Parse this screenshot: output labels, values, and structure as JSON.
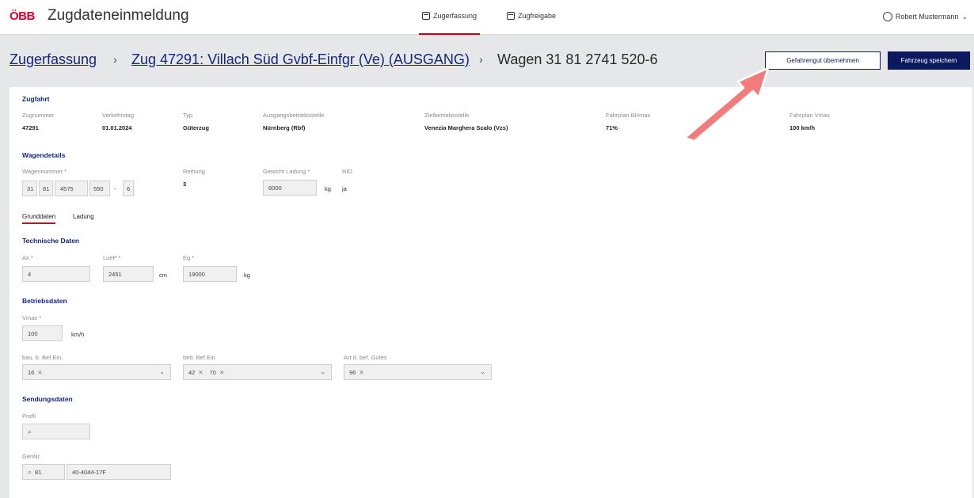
{
  "header": {
    "logo": "ÖBB",
    "title": "Zugdateneinmeldung",
    "nav": [
      {
        "label": "Zugerfassung",
        "active": true,
        "icon": "train-form-icon"
      },
      {
        "label": "Zugfreigabe",
        "active": false,
        "icon": "train-release-icon"
      }
    ],
    "user": "Robert Mustermann",
    "user_icon": "user-icon"
  },
  "breadcrumb": {
    "root": "Zugerfassung",
    "train": "Zug 47291: Villach Süd Gvbf-Einfgr (Ve) (AUSGANG)",
    "current": "Wagen 31 81 2741 520-6",
    "separator": "›"
  },
  "actions": {
    "dangerous_goods": "Gefahrengut übernehmen",
    "save": "Fahrzeug speichern"
  },
  "zugfahrt": {
    "heading": "Zugfahrt",
    "fields": [
      {
        "label": "Zugnummer",
        "value": "47291"
      },
      {
        "label": "Verkehrstag",
        "value": "01.01.2024"
      },
      {
        "label": "Typ",
        "value": "Güterzug"
      },
      {
        "label": "Ausgangsbetriebsstelle",
        "value": "Nürnberg (Rbf)"
      },
      {
        "label": "Zielbetriebsstelle",
        "value": "Venezia Marghera Scalo (Vzs)"
      },
      {
        "label": "Fahrplan BHmax",
        "value": "71%"
      },
      {
        "label": "Fahrplan Vmax",
        "value": "100 km/h"
      }
    ]
  },
  "wagendetails": {
    "heading": "Wagendetails",
    "wagennummer_label": "Wagennummer *",
    "wagennummer_parts": [
      "31",
      "81",
      "4575",
      "550",
      "-",
      "6"
    ],
    "reihung_label": "Reihung",
    "reihung_value": "3",
    "gewicht_label": "Gewicht Ladung *",
    "gewicht_value": "6000",
    "gewicht_unit": "kg",
    "rid_label": "RID",
    "rid_value": "ja"
  },
  "tabs": [
    {
      "label": "Grunddaten",
      "active": true
    },
    {
      "label": "Ladung",
      "active": false
    }
  ],
  "technische_daten": {
    "heading": "Technische Daten",
    "ax_label": "Ax *",
    "ax_value": "4",
    "luep_label": "LueP *",
    "luep_value": "2451",
    "luep_unit": "cm",
    "eg_label": "Eg *",
    "eg_value": "19000",
    "eg_unit": "kg"
  },
  "betriebsdaten": {
    "heading": "Betriebsdaten",
    "vmax_label": "Vmax *",
    "vmax_value": "100",
    "vmax_unit": "km/h",
    "bau_label": "bau. b. Bef.Ein.",
    "bau_chips": [
      "16"
    ],
    "betr_label": "betr. Bef.Ein",
    "betr_chips": [
      "42",
      "70"
    ],
    "art_label": "Art d. bef. Gutes",
    "art_chips": [
      "96"
    ]
  },
  "sendungsdaten": {
    "heading": "Sendungsdaten",
    "profil_label": "Profil",
    "profil_value": "",
    "gennr_label": "GenNr.",
    "gennr_prefix": "81",
    "gennr_value": "40-4044-17F"
  },
  "colors": {
    "brand_red": "#e2002a",
    "primary_navy": "#0b1a5e",
    "annotation_arrow": "#f47b7b"
  }
}
